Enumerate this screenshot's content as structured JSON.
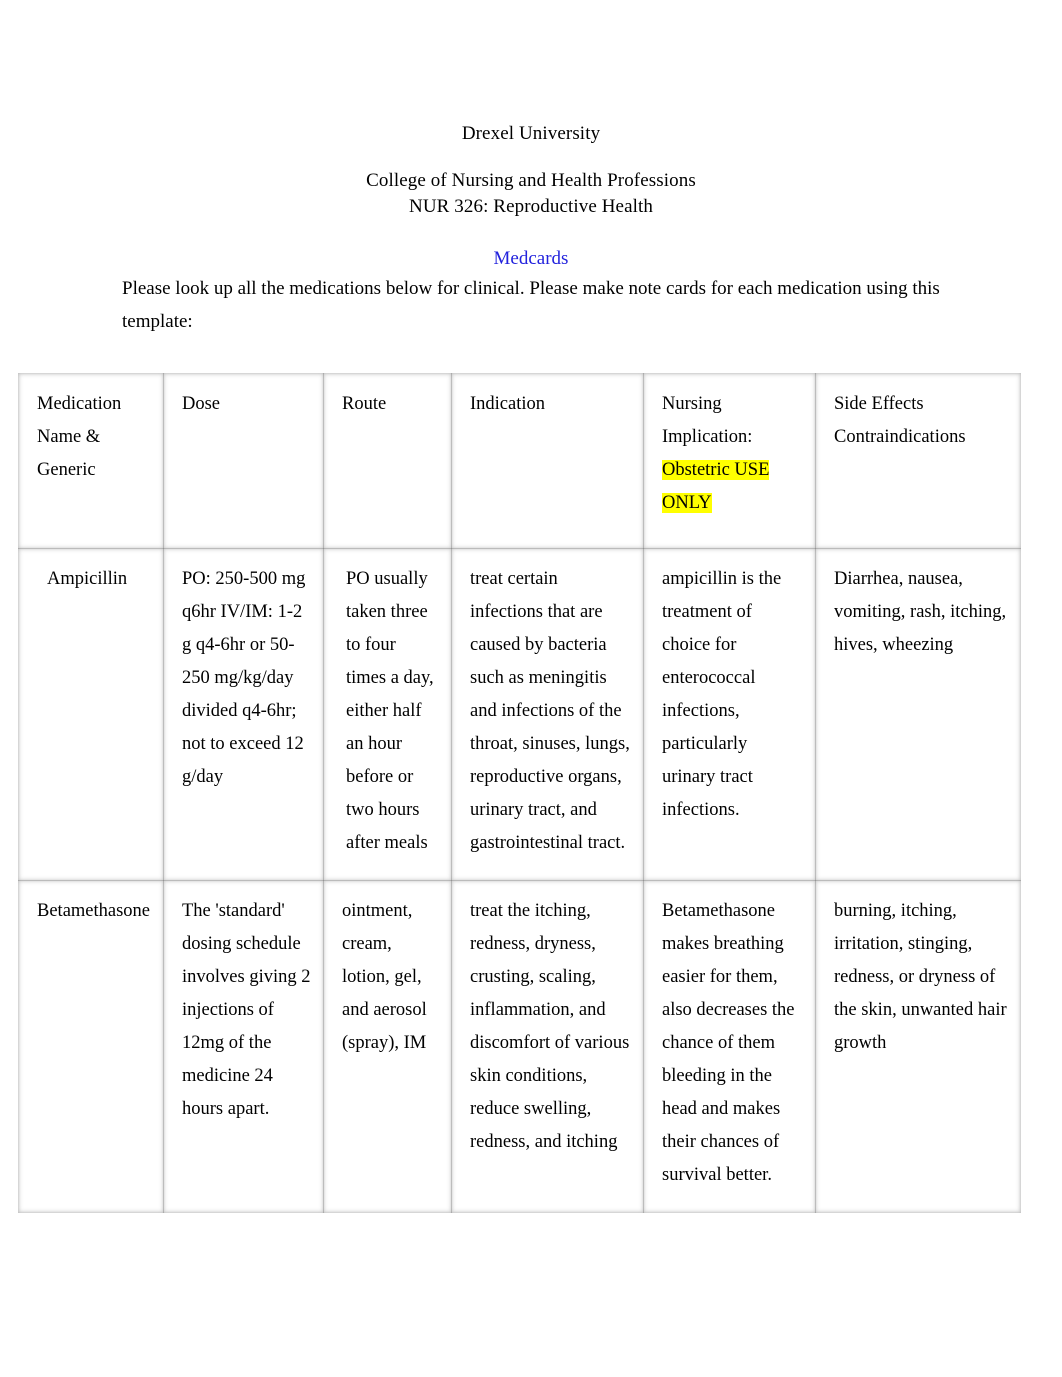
{
  "document": {
    "university": "Drexel University",
    "college": "College of Nursing and Health Professions",
    "course": "NUR 326: Reproductive Health",
    "section_link": "Medcards",
    "instructions": "Please look up all the medications below for clinical. Please make note cards for each medication using this template:",
    "link_color": "#2222dd",
    "highlight_color": "#ffff00"
  },
  "table": {
    "headers": {
      "medication": {
        "line1": "Medication",
        "line2": "Name &",
        "line3": "Generic"
      },
      "dose": "Dose",
      "route": "Route",
      "indication": "Indication",
      "nursing": {
        "line1": "Nursing",
        "line2": "Implication:",
        "highlighted": "Obstetric USE ONLY"
      },
      "side_effects": {
        "line1": "Side Effects",
        "line2": "Contraindications"
      }
    },
    "rows": [
      {
        "name": "Ampicillin",
        "dose": "PO: 250-500 mg q6hr IV/IM: 1-2 g q4-6hr or 50-250 mg/kg/day divided q4-6hr; not to exceed 12 g/day",
        "route": "PO usually taken three to four times a day, either half an hour before or two hours after meals",
        "indication": "treat certain infections that are caused by bacteria such as meningitis and infections of the throat, sinuses, lungs, reproductive organs, urinary tract, and gastrointestinal tract.",
        "nursing": "ampicillin is the treatment of choice for enterococcal infections, particularly urinary tract infections.",
        "side_effects": "Diarrhea, nausea, vomiting, rash, itching, hives, wheezing"
      },
      {
        "name": "Betamethasone",
        "dose": "The 'standard' dosing schedule involves giving 2 injections of 12mg of the medicine 24 hours apart.",
        "route": "ointment, cream, lotion, gel, and aerosol (spray), IM",
        "indication": "treat the itching, redness, dryness, crusting, scaling, inflammation, and discomfort of various skin conditions, reduce swelling, redness, and itching",
        "nursing": "Betamethasone makes breathing easier for them, also decreases the chance of them bleeding in the head and makes their chances of survival better.",
        "side_effects": "burning, itching, irritation, stinging, redness, or dryness of the skin, unwanted hair growth"
      }
    ]
  }
}
